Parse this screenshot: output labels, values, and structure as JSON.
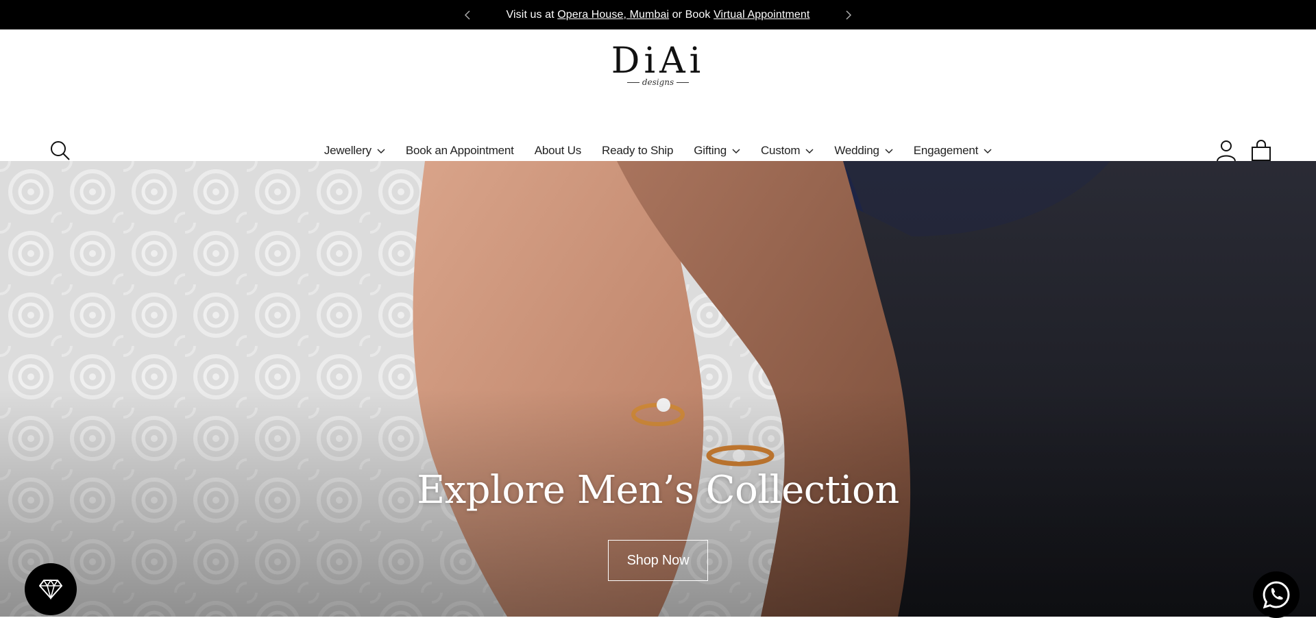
{
  "announcement": {
    "prefix": "Visit us at ",
    "location_link": "Opera House, Mumbai",
    "middle": " or Book ",
    "appointment_link": "Virtual Appointment",
    "prev_icon": "chevron-left-icon",
    "next_icon": "chevron-right-icon"
  },
  "logo": {
    "brand": "DiAi",
    "tagline": "designs"
  },
  "nav": {
    "items": [
      {
        "label": "Jewellery",
        "has_dropdown": true
      },
      {
        "label": "Book an Appointment",
        "has_dropdown": false
      },
      {
        "label": "About Us",
        "has_dropdown": false
      },
      {
        "label": "Ready to Ship",
        "has_dropdown": false
      },
      {
        "label": "Gifting",
        "has_dropdown": true
      },
      {
        "label": "Custom",
        "has_dropdown": true
      },
      {
        "label": "Wedding",
        "has_dropdown": true
      },
      {
        "label": "Engagement",
        "has_dropdown": true
      }
    ]
  },
  "header_icons": {
    "search": "search-icon",
    "account": "account-icon",
    "cart": "shopping-bag-icon",
    "cart_count": "0"
  },
  "hero": {
    "title": "Explore Men’s Collection",
    "button_label": "Shop Now"
  },
  "floating": {
    "left_icon": "diamond-icon",
    "right_icon": "whatsapp-icon"
  },
  "colors": {
    "announcement_bg": "#000000",
    "text_primary": "#111111",
    "hero_text": "#ffffff"
  }
}
